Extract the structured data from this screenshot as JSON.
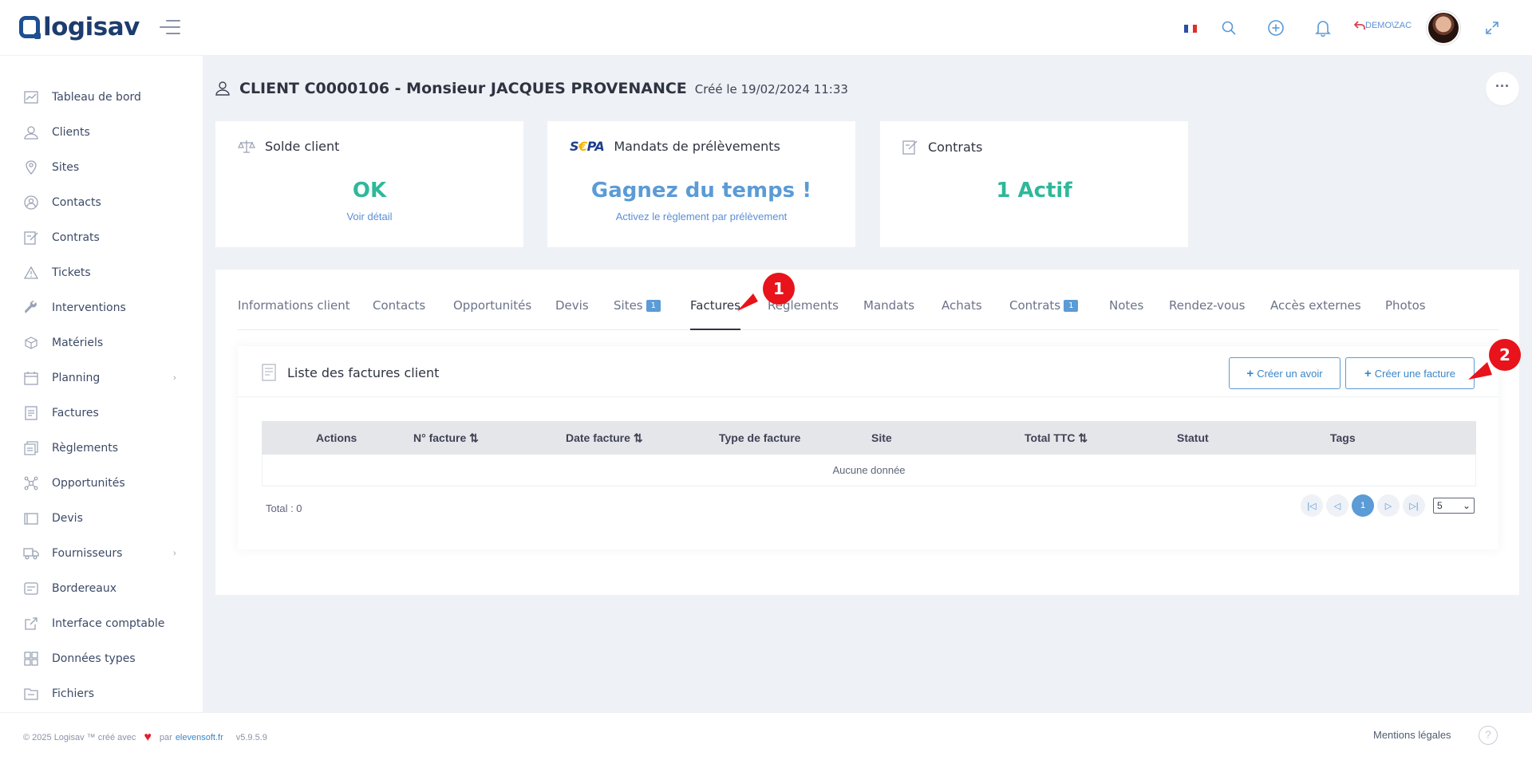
{
  "brand": {
    "logo_text": "logisav"
  },
  "header": {
    "user_label": "DEMO\\ZAC",
    "icons": [
      "french-flag-icon",
      "search-icon",
      "add-circle-icon",
      "bell-icon",
      "expand-icon"
    ]
  },
  "sidebar": {
    "items": [
      {
        "label": "Tableau de bord",
        "icon": "dashboard-icon"
      },
      {
        "label": "Clients",
        "icon": "user-icon"
      },
      {
        "label": "Sites",
        "icon": "location-icon"
      },
      {
        "label": "Contacts",
        "icon": "contacts-icon"
      },
      {
        "label": "Contrats",
        "icon": "contract-icon"
      },
      {
        "label": "Tickets",
        "icon": "warning-icon"
      },
      {
        "label": "Interventions",
        "icon": "wrench-icon"
      },
      {
        "label": "Matériels",
        "icon": "box-icon"
      },
      {
        "label": "Planning",
        "icon": "calendar-icon",
        "expandable": true
      },
      {
        "label": "Factures",
        "icon": "invoice-icon"
      },
      {
        "label": "Règlements",
        "icon": "payment-icon"
      },
      {
        "label": "Opportunités",
        "icon": "network-icon"
      },
      {
        "label": "Devis",
        "icon": "quote-icon"
      },
      {
        "label": "Fournisseurs",
        "icon": "truck-icon",
        "expandable": true
      },
      {
        "label": "Bordereaux",
        "icon": "slip-icon"
      },
      {
        "label": "Interface comptable",
        "icon": "export-icon"
      },
      {
        "label": "Données types",
        "icon": "grid-icon"
      },
      {
        "label": "Fichiers",
        "icon": "folder-icon"
      }
    ]
  },
  "page": {
    "title": "CLIENT C0000106 - Monsieur JACQUES PROVENANCE",
    "created": "Créé le 19/02/2024 11:33",
    "more_label": "···"
  },
  "cards": {
    "solde": {
      "title": "Solde client",
      "value": "OK",
      "link": "Voir détail"
    },
    "mandats": {
      "logo": "SEPA",
      "title": "Mandats de prélèvements",
      "value": "Gagnez du temps !",
      "link": "Activez le règlement par prélèvement"
    },
    "contrats": {
      "title": "Contrats",
      "value": "1 Actif"
    }
  },
  "tabs": [
    {
      "label": "Informations client"
    },
    {
      "label": "Contacts"
    },
    {
      "label": "Opportunités"
    },
    {
      "label": "Devis"
    },
    {
      "label": "Sites",
      "badge": "1"
    },
    {
      "label": "Factures",
      "active": true
    },
    {
      "label": "Règlements"
    },
    {
      "label": "Mandats"
    },
    {
      "label": "Achats"
    },
    {
      "label": "Contrats",
      "badge": "1"
    },
    {
      "label": "Notes"
    },
    {
      "label": "Rendez-vous"
    },
    {
      "label": "Accès externes"
    },
    {
      "label": "Photos"
    }
  ],
  "invoices": {
    "title": "Liste des factures client",
    "btn_avoir": "Créer un avoir",
    "btn_facture": "Créer une facture",
    "columns": [
      "Actions",
      "N° facture",
      "Date facture",
      "Type de facture",
      "Site",
      "Total TTC",
      "Statut",
      "Tags"
    ],
    "empty": "Aucune donnée",
    "total": "Total : 0",
    "current_page": "1",
    "page_size": "5"
  },
  "markers": [
    "1",
    "2"
  ],
  "footer": {
    "copyright": "© 2025 Logisav ™ créé avec",
    "by": "par",
    "link": "elevensoft.fr",
    "version": "v5.9.5.9",
    "mentions": "Mentions légales",
    "help": "?"
  },
  "colors": {
    "accent": "#5b9bd6",
    "success": "#2fb89a",
    "brand": "#1d3c6e",
    "marker": "#e8131b"
  }
}
